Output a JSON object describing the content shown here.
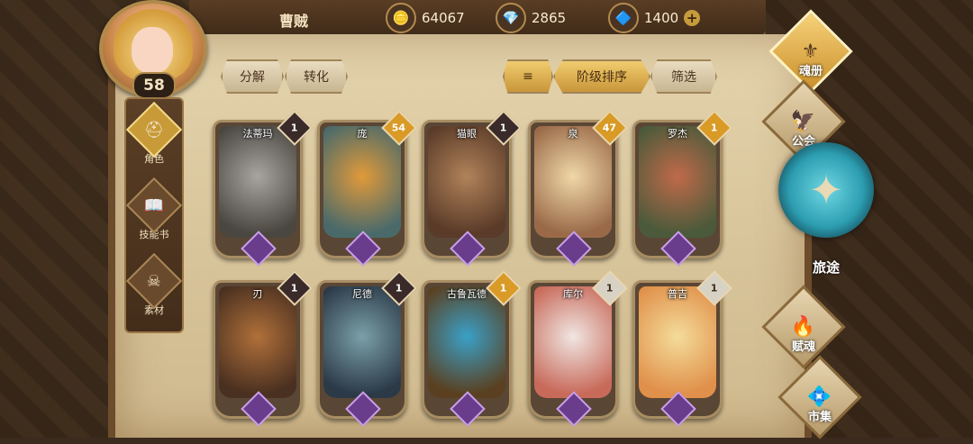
{
  "player": {
    "name": "曹贼",
    "level": "58"
  },
  "resources": [
    {
      "icon": "gold-coin-icon",
      "value": "64067"
    },
    {
      "icon": "blue-crystal-icon",
      "value": "2865"
    },
    {
      "icon": "pink-gem-icon",
      "value": "1400"
    }
  ],
  "sidenav": [
    "角色",
    "技能书",
    "素材"
  ],
  "actions": {
    "decompose": "分解",
    "convert": "转化",
    "sort_rank": "阶级排序",
    "filter": "筛选"
  },
  "cards": [
    {
      "name": "法蒂玛",
      "count": "1",
      "badge": "dark",
      "c1": "#a8a4a0",
      "c2": "#4a4640"
    },
    {
      "name": "庞",
      "count": "54",
      "badge": "gold",
      "c1": "#e19a3a",
      "c2": "#4a6a6a"
    },
    {
      "name": "猫眼",
      "count": "1",
      "badge": "dark",
      "c1": "#b0835a",
      "c2": "#5a3a28"
    },
    {
      "name": "泉",
      "count": "47",
      "badge": "gold",
      "c1": "#f0d8a8",
      "c2": "#9a6a48"
    },
    {
      "name": "罗杰",
      "count": "1",
      "badge": "gold",
      "c1": "#c06a4a",
      "c2": "#4a5a3a"
    },
    {
      "name": "刃",
      "count": "1",
      "badge": "dark",
      "c1": "#b0703a",
      "c2": "#4a3020"
    },
    {
      "name": "尼德",
      "count": "1",
      "badge": "dark",
      "c1": "#7aa0a8",
      "c2": "#2c3a48"
    },
    {
      "name": "古鲁瓦德",
      "count": "1",
      "badge": "gold",
      "c1": "#3aa0c8",
      "c2": "#5a4020"
    },
    {
      "name": "库尔",
      "count": "1",
      "badge": "white",
      "c1": "#f0e6e2",
      "c2": "#c86a5a"
    },
    {
      "name": "普吉",
      "count": "1",
      "badge": "white",
      "c1": "#f4dc9a",
      "c2": "#e0904a"
    }
  ],
  "rightnav": {
    "soulbook": "魂册",
    "guild": "公会",
    "journey": "旅途",
    "talent": "赋魂",
    "market": "市集"
  }
}
